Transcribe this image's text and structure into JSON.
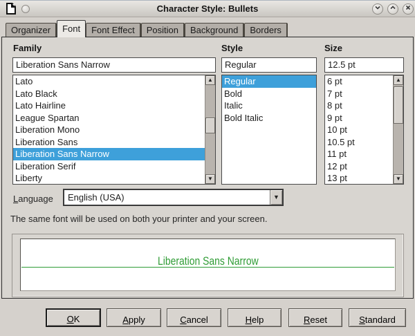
{
  "window": {
    "title": "Character Style: Bullets"
  },
  "titlebar": {
    "icons": [
      "document-icon",
      "menu-dot-icon",
      "roll-down-icon",
      "roll-up-icon",
      "close-icon"
    ],
    "roll_down_glyph": "v",
    "roll_up_glyph": "^",
    "close_glyph": "x"
  },
  "tabs": [
    {
      "label": "Organizer",
      "active": false
    },
    {
      "label": "Font",
      "active": true
    },
    {
      "label": "Font Effect",
      "active": false
    },
    {
      "label": "Position",
      "active": false
    },
    {
      "label": "Background",
      "active": false
    },
    {
      "label": "Borders",
      "active": false
    }
  ],
  "font_tab": {
    "family": {
      "label": "Family",
      "value": "Liberation Sans Narrow",
      "items": [
        "Lato",
        "Lato Black",
        "Lato Hairline",
        "League Spartan",
        "Liberation Mono",
        "Liberation Sans",
        "Liberation Sans Narrow",
        "Liberation Serif",
        "Liberty"
      ],
      "selected_index": 6
    },
    "style": {
      "label": "Style",
      "value": "Regular",
      "items": [
        "Regular",
        "Bold",
        "Italic",
        "Bold Italic"
      ],
      "selected_index": 0
    },
    "size": {
      "label": "Size",
      "value": "12.5 pt",
      "items": [
        "6 pt",
        "7 pt",
        "8 pt",
        "9 pt",
        "10 pt",
        "10.5 pt",
        "11 pt",
        "12 pt",
        "13 pt"
      ],
      "selected_index": -1
    },
    "language": {
      "label": "Language",
      "value": "English (USA)"
    },
    "info_text": "The same font will be used on both your printer and your screen.",
    "preview_text": "Liberation Sans Narrow"
  },
  "buttons": [
    {
      "label": "OK",
      "default": true
    },
    {
      "label": "Apply",
      "default": false
    },
    {
      "label": "Cancel",
      "default": false
    },
    {
      "label": "Help",
      "default": false
    },
    {
      "label": "Reset",
      "default": false
    },
    {
      "label": "Standard",
      "default": false
    }
  ],
  "colors": {
    "selection_blue": "#3ea0da",
    "preview_green": "#2f9c35",
    "dialog_background": "#d5d1cc"
  }
}
